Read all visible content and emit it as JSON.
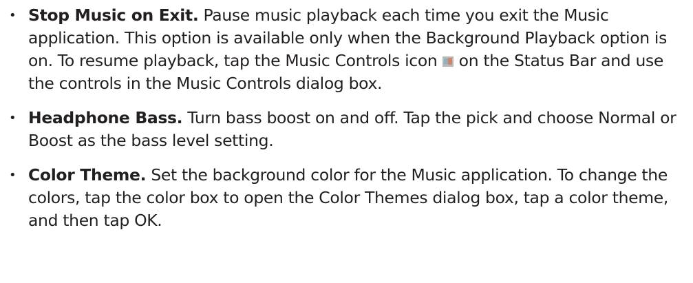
{
  "items": [
    {
      "term": "Stop Music on Exit.",
      "text_before_icon": " Pause music playback each time you exit the Music application. This option is available only when the Background Playback option is on. To resume playback, tap the Music Controls icon",
      "icon": "music-controls-icon",
      "text_after_icon": " on the Status Bar and use the controls in the Music Controls dialog box."
    },
    {
      "term": "Headphone Bass.",
      "text": " Turn bass boost on and off. Tap the pick and choose Normal or Boost as the bass level setting."
    },
    {
      "term": "Color Theme.",
      "text": " Set the background color for the Music application. To change the colors, tap the color box to open the Color Themes dialog box, tap a color theme, and then tap OK."
    }
  ],
  "bullet_glyph": "•"
}
